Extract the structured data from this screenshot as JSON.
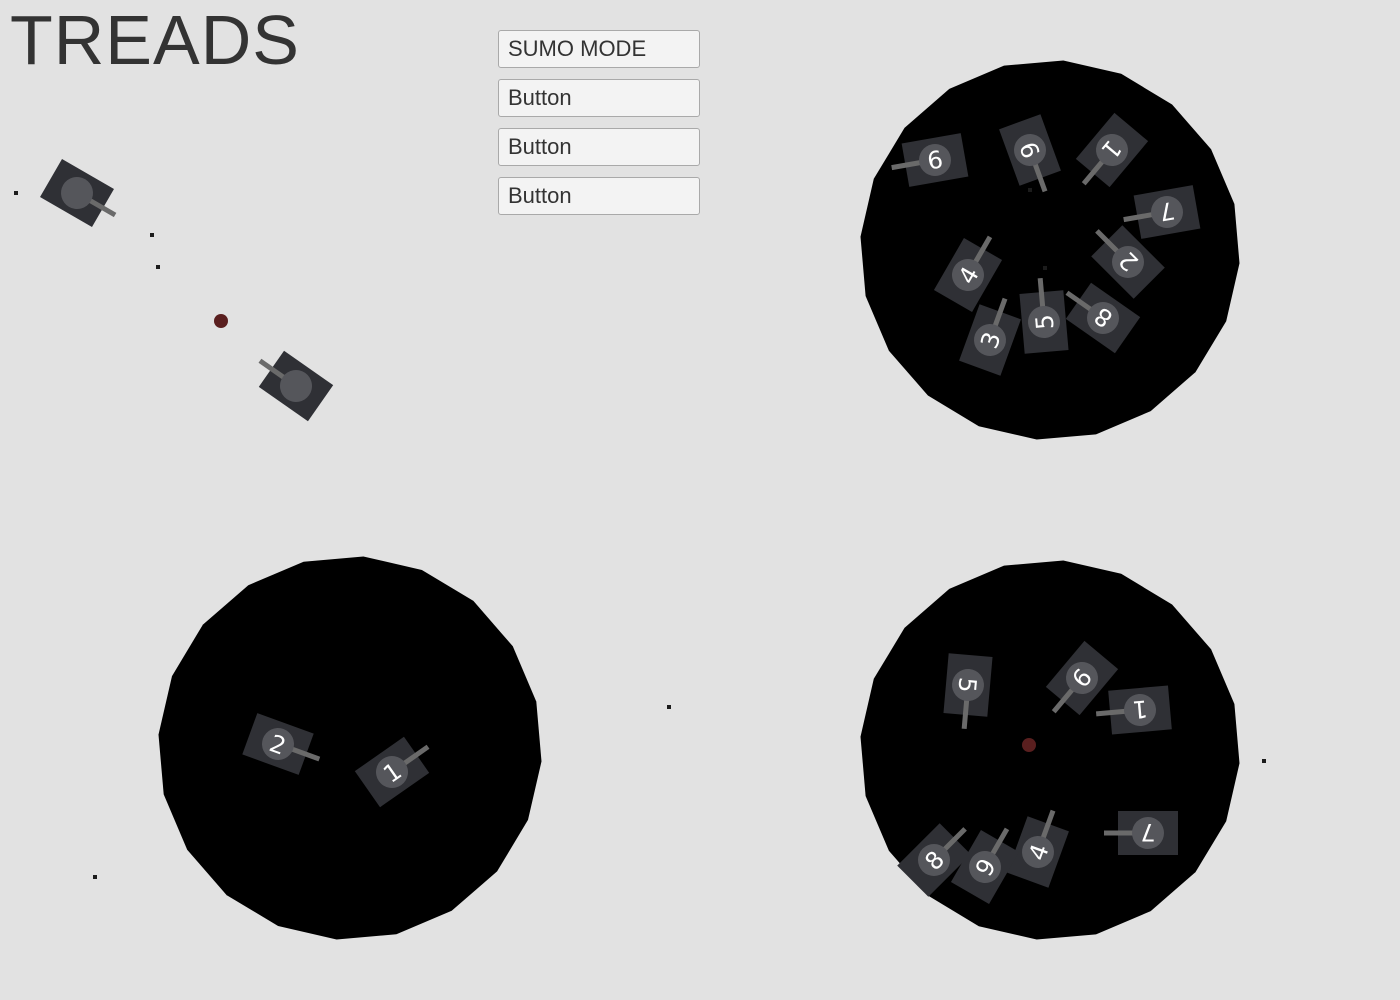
{
  "app": {
    "title": "TREADS"
  },
  "menu": {
    "buttons": [
      {
        "label": "SUMO MODE"
      },
      {
        "label": "Button"
      },
      {
        "label": "Button"
      },
      {
        "label": "Button"
      }
    ]
  },
  "colors": {
    "background": "#e2e2e2",
    "arena": "#000000",
    "tank_body": "#2f3035",
    "tank_turret": "#55565b",
    "tank_barrel": "#6a6a6a",
    "ball": "#5a1f1f"
  },
  "arenas": [
    {
      "name": "top-right-arena",
      "tanks": [
        {
          "label": "9",
          "heading": 170
        },
        {
          "label": "6",
          "heading": 70
        },
        {
          "label": "1",
          "heading": 130
        },
        {
          "label": "7",
          "heading": 170
        },
        {
          "label": "2",
          "heading": 225
        },
        {
          "label": "4",
          "heading": -60
        },
        {
          "label": "3",
          "heading": -70
        },
        {
          "label": "5",
          "heading": -95
        },
        {
          "label": "8",
          "heading": 215
        }
      ]
    },
    {
      "name": "bottom-left-arena",
      "tanks": [
        {
          "label": "2",
          "heading": 20
        },
        {
          "label": "1",
          "heading": -35
        }
      ]
    },
    {
      "name": "bottom-right-arena",
      "tanks": [
        {
          "label": "5",
          "heading": 95
        },
        {
          "label": "9",
          "heading": 130
        },
        {
          "label": "1",
          "heading": 175
        },
        {
          "label": "7",
          "heading": 180
        },
        {
          "label": "4",
          "heading": -70
        },
        {
          "label": "9",
          "heading": -60
        },
        {
          "label": "8",
          "heading": -45
        }
      ]
    }
  ],
  "free_tanks": [
    {
      "label": "",
      "heading": 30
    },
    {
      "label": "",
      "heading": 215
    }
  ]
}
